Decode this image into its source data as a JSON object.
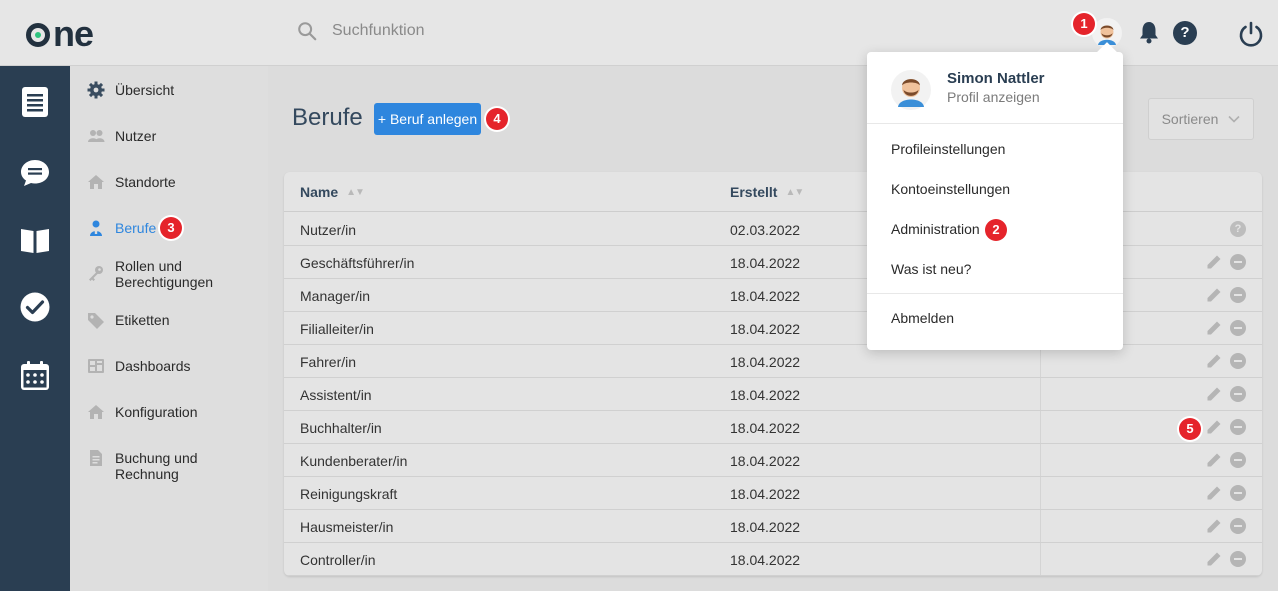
{
  "app": {
    "logo": "one",
    "search_placeholder": "Suchfunktion"
  },
  "badges": {
    "b1": "1",
    "b2": "2",
    "b3": "3",
    "b4": "4",
    "b5": "5"
  },
  "icons": {
    "rail": [
      "document-icon",
      "chat-icon",
      "book-icon",
      "check-circle-icon",
      "calendar-icon"
    ],
    "top": [
      "avatar-icon",
      "bell-icon",
      "help-icon",
      "power-icon"
    ]
  },
  "sidebar": {
    "items": [
      {
        "label": "Übersicht",
        "icon": "gear-icon"
      },
      {
        "label": "Nutzer",
        "icon": "users-icon"
      },
      {
        "label": "Standorte",
        "icon": "house-icon"
      },
      {
        "label": "Berufe",
        "icon": "person-icon",
        "active": true
      },
      {
        "label": "Rollen und Berechtigungen",
        "icon": "key-icon"
      },
      {
        "label": "Etiketten",
        "icon": "tag-icon"
      },
      {
        "label": "Dashboards",
        "icon": "dashboard-icon"
      },
      {
        "label": "Konfiguration",
        "icon": "house-icon"
      },
      {
        "label": "Buchung und Rechnung",
        "icon": "invoice-icon"
      }
    ]
  },
  "main": {
    "title": "Berufe",
    "add_button": "+ Beruf anlegen",
    "sort_button": "Sortieren",
    "columns": [
      "Name",
      "Erstellt"
    ],
    "rows": [
      {
        "name": "Nutzer/in",
        "created": "02.03.2022"
      },
      {
        "name": "Geschäftsführer/in",
        "created": "18.04.2022"
      },
      {
        "name": "Manager/in",
        "created": "18.04.2022"
      },
      {
        "name": "Filialleiter/in",
        "created": "18.04.2022"
      },
      {
        "name": "Fahrer/in",
        "created": "18.04.2022"
      },
      {
        "name": "Assistent/in",
        "created": "18.04.2022"
      },
      {
        "name": "Buchhalter/in",
        "created": "18.04.2022"
      },
      {
        "name": "Kundenberater/in",
        "created": "18.04.2022"
      },
      {
        "name": "Reinigungskraft",
        "created": "18.04.2022"
      },
      {
        "name": "Hausmeister/in",
        "created": "18.04.2022"
      },
      {
        "name": "Controller/in",
        "created": "18.04.2022"
      }
    ]
  },
  "dropdown": {
    "name": "Simon Nattler",
    "subtitle": "Profil anzeigen",
    "items": [
      "Profileinstellungen",
      "Kontoeinstellungen",
      "Administration",
      "Was ist neu?",
      "Abmelden"
    ]
  },
  "colors": {
    "accent": "#2e86de",
    "rail": "#2a3e52",
    "badge": "#e5242b"
  }
}
